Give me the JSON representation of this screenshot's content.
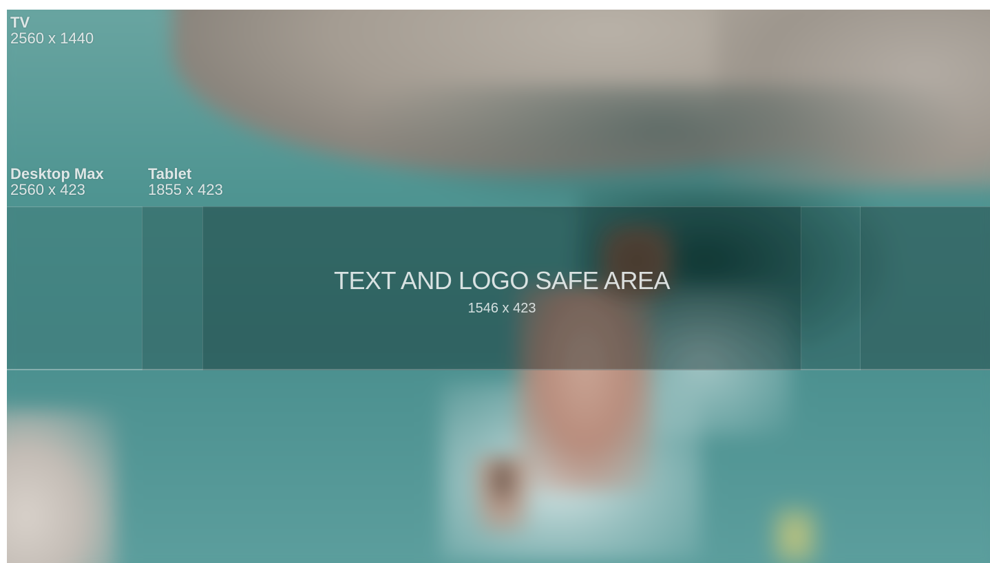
{
  "regions": {
    "tv": {
      "name": "TV",
      "dims": "2560 x 1440"
    },
    "desktop_max": {
      "name": "Desktop Max",
      "dims": "2560 x 423"
    },
    "tablet": {
      "name": "Tablet",
      "dims": "1855 x 423"
    },
    "safe_area": {
      "name": "TEXT AND LOGO SAFE AREA",
      "dims": "1546 x 423"
    }
  },
  "colors": {
    "label_text": "#ebf0f0",
    "water": "#4e8f8d"
  }
}
